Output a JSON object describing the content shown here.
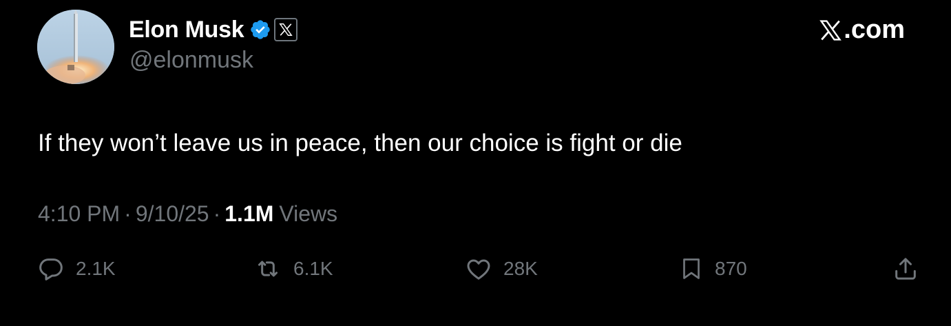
{
  "author": {
    "display_name": "Elon Musk",
    "handle": "@elonmusk",
    "avatar_icon": "rocket-launch-avatar",
    "verified_icon": "verified-badge-icon",
    "affiliate_icon": "x-logo-icon"
  },
  "brand": {
    "label": ".com",
    "icon": "x-logo-icon"
  },
  "tweet": {
    "text": "If they won’t leave us in peace, then our choice is fight or die"
  },
  "meta": {
    "time": "4:10 PM",
    "separator": "·",
    "date": "9/10/25",
    "views_count": "1.1M",
    "views_label": "Views"
  },
  "actions": {
    "reply": {
      "icon": "reply-icon",
      "count": "2.1K"
    },
    "repost": {
      "icon": "repost-icon",
      "count": "6.1K"
    },
    "like": {
      "icon": "heart-icon",
      "count": "28K"
    },
    "bookmark": {
      "icon": "bookmark-icon",
      "count": "870"
    },
    "share": {
      "icon": "share-icon"
    }
  },
  "colors": {
    "background": "#000000",
    "primary_text": "#ffffff",
    "secondary_text": "#71767b",
    "verified_blue": "#1d9bf0"
  }
}
